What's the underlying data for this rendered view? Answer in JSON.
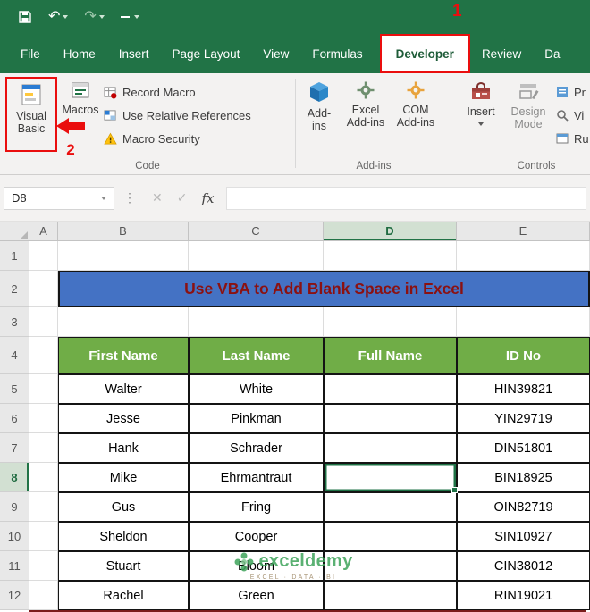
{
  "titlebar": {
    "undo_glyph": "↶",
    "redo_glyph": "↷"
  },
  "callouts": {
    "one": "1",
    "two": "2"
  },
  "tabs": {
    "items": [
      "File",
      "Home",
      "Insert",
      "Page Layout",
      "View",
      "Formulas",
      "Developer",
      "Review",
      "Da"
    ],
    "active": "Developer"
  },
  "ribbon": {
    "visual_basic": "Visual Basic",
    "macros": "Macros",
    "record_macro": "Record Macro",
    "use_relative_references": "Use Relative References",
    "macro_security": "Macro Security",
    "group_code": "Code",
    "addins_button": "Add-ins",
    "excel_addins": "Excel Add-ins",
    "com_addins": "COM Add-ins",
    "group_addins": "Add-ins",
    "insert": "Insert",
    "design_mode": "Design Mode",
    "group_controls": "Controls",
    "right_items": [
      "Pr",
      "Vi",
      "Ru"
    ]
  },
  "formula_bar": {
    "name_box": "D8",
    "dots": "⋮",
    "cancel": "✕",
    "enter": "✓",
    "fx": "fx",
    "value": ""
  },
  "sheet": {
    "col_headers": [
      "A",
      "B",
      "C",
      "D",
      "E"
    ],
    "row_headers": [
      "1",
      "2",
      "3",
      "4",
      "5",
      "6",
      "7",
      "8",
      "9",
      "10",
      "11",
      "12"
    ],
    "selected_column": "D",
    "selected_row": "8",
    "active_cell": "D8",
    "title": "Use VBA to Add Blank Space in Excel"
  },
  "table": {
    "headers": [
      "First Name",
      "Last Name",
      "Full Name",
      "ID No"
    ],
    "rows": [
      [
        "Walter",
        "White",
        "",
        "HIN39821"
      ],
      [
        "Jesse",
        "Pinkman",
        "",
        "YIN29719"
      ],
      [
        "Hank",
        "Schrader",
        "",
        "DIN51801"
      ],
      [
        "Mike",
        "Ehrmantraut",
        "",
        "BIN18925"
      ],
      [
        "Gus",
        "Fring",
        "",
        "OIN82719"
      ],
      [
        "Sheldon",
        "Cooper",
        "",
        "SIN10927"
      ],
      [
        "Stuart",
        "Bloom",
        "",
        "CIN38012"
      ],
      [
        "Rachel",
        "Green",
        "",
        "RIN19021"
      ]
    ]
  },
  "watermark": {
    "brand": "exceldemy",
    "tagline": "EXCEL · DATA · BI"
  },
  "colors": {
    "excel_green": "#217346",
    "table_header_green": "#70AD47",
    "title_fill_blue": "#4472C4",
    "title_text_red": "#8B1111",
    "annotation_red": "#EA0E0E",
    "selection_green": "#1E7145",
    "bottom_strip_maroon": "#7A1D1D"
  }
}
